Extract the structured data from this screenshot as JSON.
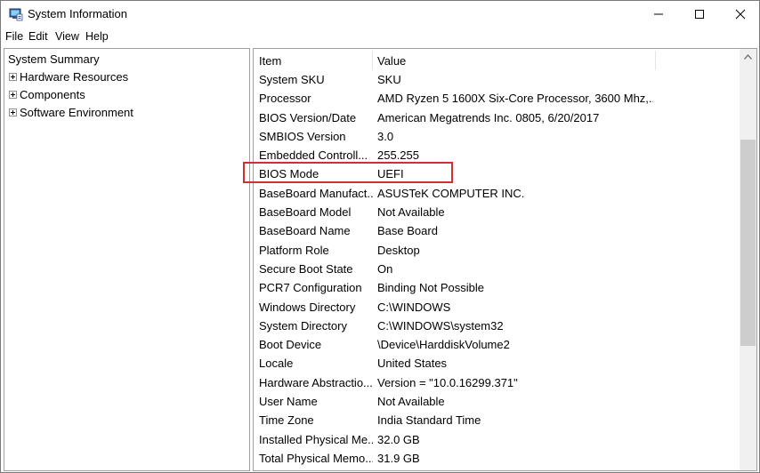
{
  "window": {
    "title": "System Information"
  },
  "menu": [
    "File",
    "Edit",
    "View",
    "Help"
  ],
  "tree": {
    "root": "System Summary",
    "children": [
      "Hardware Resources",
      "Components",
      "Software Environment"
    ]
  },
  "table": {
    "headers": {
      "item": "Item",
      "value": "Value"
    },
    "rows": [
      {
        "item": "System SKU",
        "value": "SKU"
      },
      {
        "item": "Processor",
        "value": "AMD Ryzen 5 1600X Six-Core Processor, 3600 Mhz,..."
      },
      {
        "item": "BIOS Version/Date",
        "value": "American Megatrends Inc. 0805, 6/20/2017"
      },
      {
        "item": "SMBIOS Version",
        "value": "3.0"
      },
      {
        "item": "Embedded Controll...",
        "value": "255.255"
      },
      {
        "item": "BIOS Mode",
        "value": "UEFI"
      },
      {
        "item": "BaseBoard Manufact...",
        "value": "ASUSTeK COMPUTER INC."
      },
      {
        "item": "BaseBoard Model",
        "value": "Not Available"
      },
      {
        "item": "BaseBoard Name",
        "value": "Base Board"
      },
      {
        "item": "Platform Role",
        "value": "Desktop"
      },
      {
        "item": "Secure Boot State",
        "value": "On"
      },
      {
        "item": "PCR7 Configuration",
        "value": "Binding Not Possible"
      },
      {
        "item": "Windows Directory",
        "value": "C:\\WINDOWS"
      },
      {
        "item": "System Directory",
        "value": "C:\\WINDOWS\\system32"
      },
      {
        "item": "Boot Device",
        "value": "\\Device\\HarddiskVolume2"
      },
      {
        "item": "Locale",
        "value": "United States"
      },
      {
        "item": "Hardware Abstractio...",
        "value": "Version = \"10.0.16299.371\""
      },
      {
        "item": "User Name",
        "value": "Not Available"
      },
      {
        "item": "Time Zone",
        "value": "India Standard Time"
      },
      {
        "item": "Installed Physical Me...",
        "value": "32.0 GB"
      },
      {
        "item": "Total Physical Memo...",
        "value": "31.9 GB"
      }
    ]
  },
  "colors": {
    "highlight": "#d32f2f",
    "scroll_thumb": "#cdcdcd",
    "scroll_track": "#f0f0f0"
  }
}
